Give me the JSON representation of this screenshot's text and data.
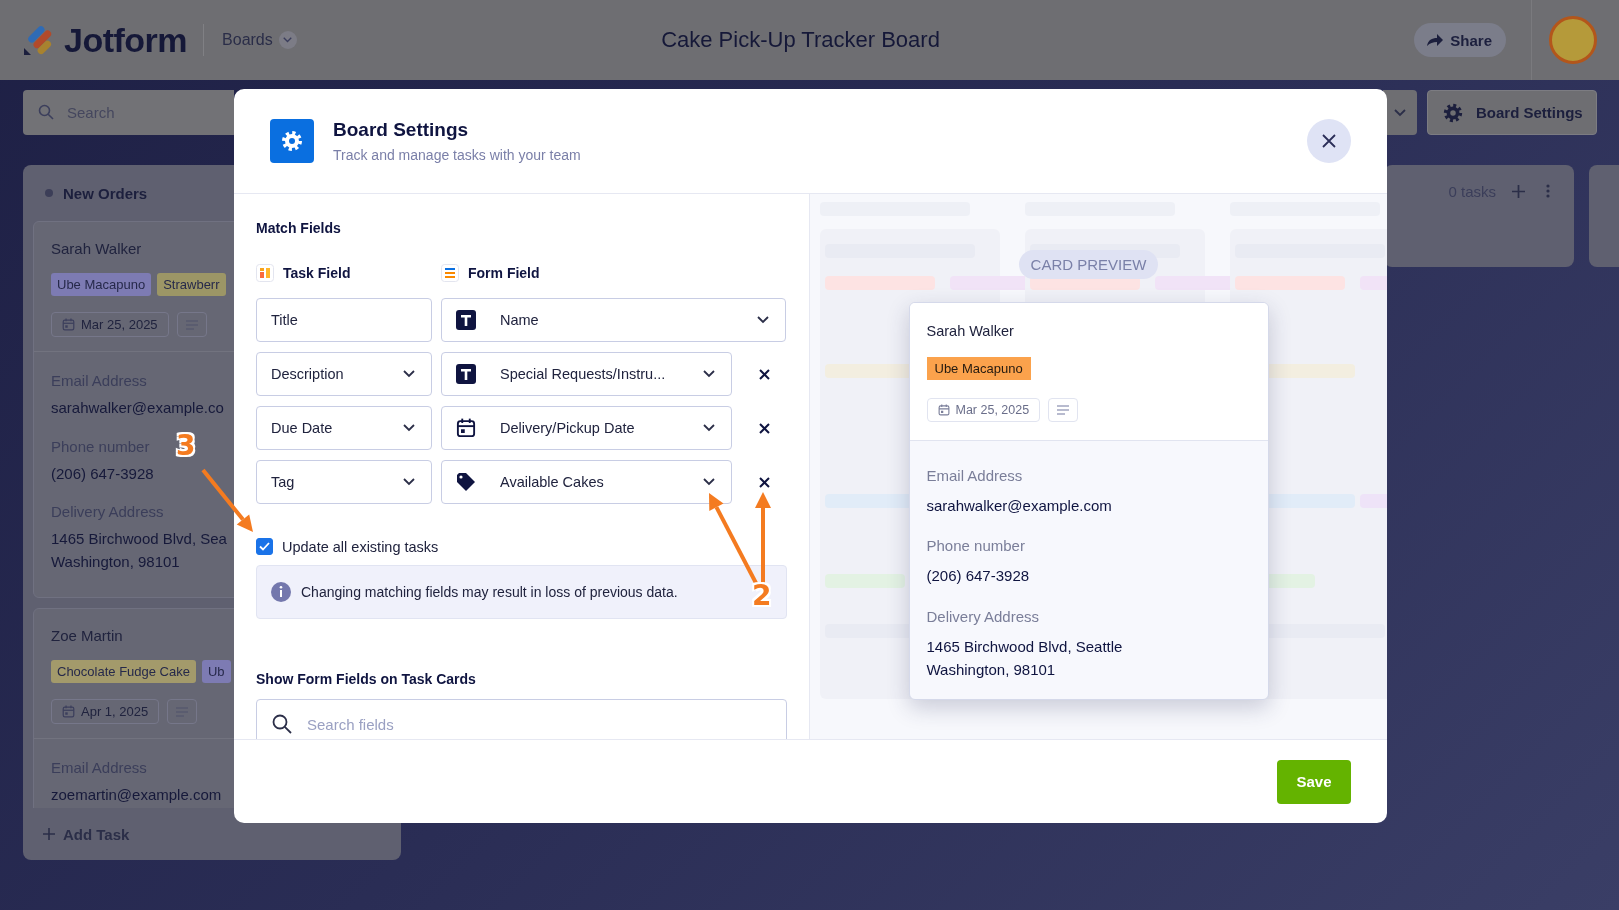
{
  "header": {
    "logo_text": "Jotform",
    "boards_menu": "Boards",
    "board_title": "Cake Pick-Up Tracker Board",
    "share_button": "Share"
  },
  "toolbar": {
    "search_placeholder": "Search",
    "board_settings_button": "Board Settings"
  },
  "column": {
    "title": "New Orders",
    "add_task": "Add Task",
    "cards": [
      {
        "name": "Sarah Walker",
        "tags": [
          {
            "label": "Ube Macapuno",
            "color": "#7d7bb3"
          },
          {
            "label": "Strawberr",
            "color": "#9c9666"
          }
        ],
        "date": "Mar 25, 2025",
        "fields": [
          {
            "label": "Email Address",
            "value": "sarahwalker@example.co"
          },
          {
            "label": "Phone number",
            "value": "(206) 647-3928"
          },
          {
            "label": "Delivery Address",
            "value": "1465 Birchwood Blvd, Sea\nWashington, 98101"
          }
        ]
      },
      {
        "name": "Zoe Martin",
        "tags": [
          {
            "label": "Chocolate Fudge Cake",
            "color": "#a39a6b"
          },
          {
            "label": "Ub",
            "color": "#7d7bb3"
          }
        ],
        "date": "Apr 1, 2025",
        "fields": [
          {
            "label": "Email Address",
            "value": "zoemartin@example.com"
          }
        ]
      }
    ]
  },
  "right_column": {
    "task_count": "0 tasks"
  },
  "modal": {
    "title": "Board Settings",
    "subtitle": "Track and manage tasks with your team",
    "match_fields": {
      "heading": "Match Fields",
      "task_field_label": "Task Field",
      "form_field_label": "Form Field",
      "rows": [
        {
          "task_field": "Title",
          "task_dropdown": false,
          "form_field": "Name",
          "kind": "text",
          "removable": false
        },
        {
          "task_field": "Description",
          "task_dropdown": true,
          "form_field": "Special Requests/Instru...",
          "kind": "text",
          "removable": true
        },
        {
          "task_field": "Due Date",
          "task_dropdown": true,
          "form_field": "Delivery/Pickup Date",
          "kind": "date",
          "removable": true
        },
        {
          "task_field": "Tag",
          "task_dropdown": true,
          "form_field": "Available Cakes",
          "kind": "tag",
          "removable": true
        }
      ]
    },
    "update_existing": {
      "label": "Update all existing tasks",
      "checked": true
    },
    "notice": "Changing matching fields may result in loss of previous data.",
    "show_fields": {
      "heading": "Show Form Fields on Task Cards",
      "search_placeholder": "Search fields"
    },
    "preview": {
      "badge": "CARD PREVIEW",
      "card": {
        "name": "Sarah Walker",
        "tag": {
          "label": "Ube Macapuno",
          "color": "#fba24c"
        },
        "date": "Mar 25, 2025",
        "fields": [
          {
            "label": "Email Address",
            "value": "sarahwalker@example.com"
          },
          {
            "label": "Phone number",
            "value": "(206) 647-3928"
          },
          {
            "label": "Delivery Address",
            "value": "1465 Birchwood Blvd, Seattle\nWashington, 98101"
          }
        ]
      }
    },
    "save_button": "Save"
  },
  "annotations": [
    {
      "number": "3",
      "kind": "single"
    },
    {
      "number": "2",
      "kind": "double"
    }
  ]
}
